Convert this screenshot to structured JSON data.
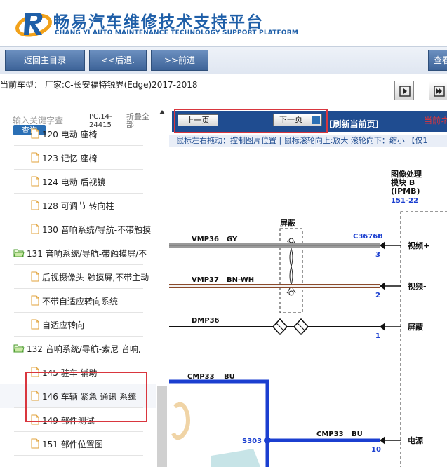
{
  "header": {
    "title_cn": "畅易汽车维修技术支持平台",
    "title_en": "CHANG YI AUTO MAINTENANCE TECHNOLOGY SUPPORT PLATFORM"
  },
  "nav": {
    "home": "返回主目录",
    "back": "<<后退.",
    "forward": ">>前进",
    "search": "查看"
  },
  "vehicle": {
    "label": "当前车型：  厂家:C-长安福特锐界(Edge)2017-2018"
  },
  "sidebar": {
    "search_placeholder": "输入关键字查",
    "search_button": "查询",
    "pc_code": "PC.14-24415",
    "fold_all": "折叠全部",
    "items": [
      {
        "label": "120 电动 座椅",
        "type": "child"
      },
      {
        "label": "123 记忆 座椅",
        "type": "child"
      },
      {
        "label": "124 电动 后视镜",
        "type": "child"
      },
      {
        "label": "128 可调节 转向柱",
        "type": "child"
      },
      {
        "label": "130 音响系统/导航-不带触摸",
        "type": "child"
      },
      {
        "label": "131 音响系统/导航-带触摸屏/不",
        "type": "folder"
      },
      {
        "label": "后视摄像头-触摸屏,不带主动",
        "type": "child"
      },
      {
        "label": "不带自适应转向系统",
        "type": "child"
      },
      {
        "label": "自适应转向",
        "type": "child"
      },
      {
        "label": "132 音响系统/导航-索尼 音响,",
        "type": "folder"
      },
      {
        "label": "145 驻车 辅助",
        "type": "child"
      },
      {
        "label": "146 车辆 紧急 通讯 系统",
        "type": "child"
      },
      {
        "label": "149 部件测试",
        "type": "child"
      },
      {
        "label": "151 部件位置图",
        "type": "child"
      }
    ]
  },
  "viewer": {
    "prev": "上一页",
    "next": "下一页",
    "refresh": "[刷新当前页]",
    "current_note": "当前ネ",
    "hint": "鼠标左右拖动：控制图片位置 | 鼠标滚轮向上:放大  滚轮向下：缩小 【仅1"
  },
  "diagram": {
    "module_title": [
      "图像处理",
      "模块 B",
      "(IPMB)"
    ],
    "module_ref": "151-22",
    "connector": "C3676B",
    "shield_label": "屏蔽",
    "wires": [
      {
        "name": "VMP36",
        "color": "GY",
        "pin": "3",
        "signal": "视频+"
      },
      {
        "name": "VMP37",
        "color": "BN-WH",
        "pin": "2",
        "signal": "视频-"
      },
      {
        "name": "DMP36",
        "color": "",
        "pin": "1",
        "signal": "屏蔽"
      }
    ],
    "power_wire_a": {
      "name": "CMP33",
      "color": "BU"
    },
    "power_wire_b": {
      "name": "CMP33",
      "color": "BU",
      "pin": "10",
      "signal": "电源"
    },
    "splice": "S303"
  },
  "colors": {
    "brand_blue": "#1f5fa8",
    "toolbar_blue": "#1f4c90",
    "highlight_red": "#d9363e",
    "wire_blue": "#1b3fd0"
  }
}
